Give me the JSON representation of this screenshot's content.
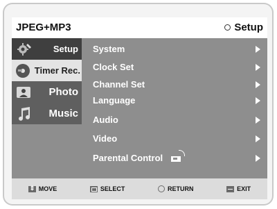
{
  "header": {
    "title": "JPEG+MP3",
    "right_label": "Setup"
  },
  "sidebar": {
    "items": [
      {
        "label": "Setup",
        "icon": "gear-icon"
      },
      {
        "label": "Timer Rec.",
        "icon": "disc-icon"
      },
      {
        "label": "Photo",
        "icon": "photo-icon"
      },
      {
        "label": "Music",
        "icon": "music-icon"
      }
    ]
  },
  "menu": {
    "items": [
      {
        "label": "System"
      },
      {
        "label": "Clock Set"
      },
      {
        "label": "Channel Set"
      },
      {
        "label": "Language"
      },
      {
        "label": "Audio"
      },
      {
        "label": "Video"
      },
      {
        "label": "Parental Control"
      }
    ]
  },
  "footer": {
    "move": "MOVE",
    "select": "SELECT",
    "return": "RETURN",
    "exit": "EXIT"
  }
}
